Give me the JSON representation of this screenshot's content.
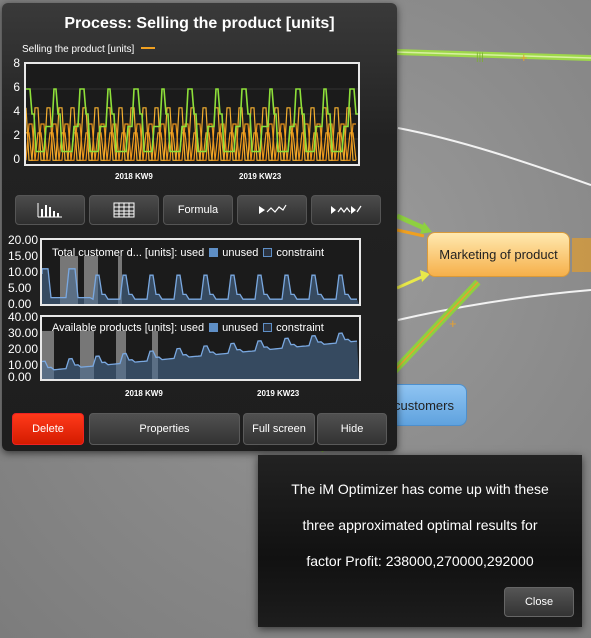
{
  "panel": {
    "title": "Process: Selling the product [units]",
    "chart1": {
      "legend": "Selling the product [units]",
      "legend_color": "#f0a020",
      "yticks": [
        "8",
        "6",
        "4",
        "2",
        "0"
      ],
      "xticks": [
        "2018 KW9",
        "2019 KW23"
      ]
    },
    "toolbar": {
      "histogram_icon": "histogram-icon",
      "table_icon": "table-icon",
      "formula_label": "Formula",
      "play_icon": "play-chart-icon",
      "fastforward_icon": "fastforward-chart-icon"
    },
    "chart2": {
      "legend_title": "Total customer d... [units]: used",
      "legend_unused": "unused",
      "legend_constraint": "constraint",
      "yticks": [
        "20.00",
        "15.00",
        "10.00",
        "5.00",
        "0.00"
      ]
    },
    "chart3": {
      "legend_title": "Available products [units]: used",
      "legend_unused": "unused",
      "legend_constraint": "constraint",
      "yticks": [
        "40.00",
        "30.00",
        "20.00",
        "10.00",
        "0.00"
      ],
      "xticks": [
        "2018 KW9",
        "2019 KW23"
      ]
    },
    "buttons": {
      "delete": "Delete",
      "properties": "Properties",
      "fullscreen": "Full screen",
      "hide": "Hide"
    }
  },
  "nodes": {
    "marketing": "Marketing of product",
    "customers": "customers"
  },
  "dialog": {
    "line1": "The iM Optimizer has come up with these",
    "line2": "three approximated optimal results for",
    "line3": "factor Profit: 238000,270000,292000",
    "close": "Close"
  },
  "colors": {
    "orange": "#f0a020",
    "green": "#8ee03a",
    "blue": "#5f8fc6",
    "delete_red": "#e82a10"
  }
}
